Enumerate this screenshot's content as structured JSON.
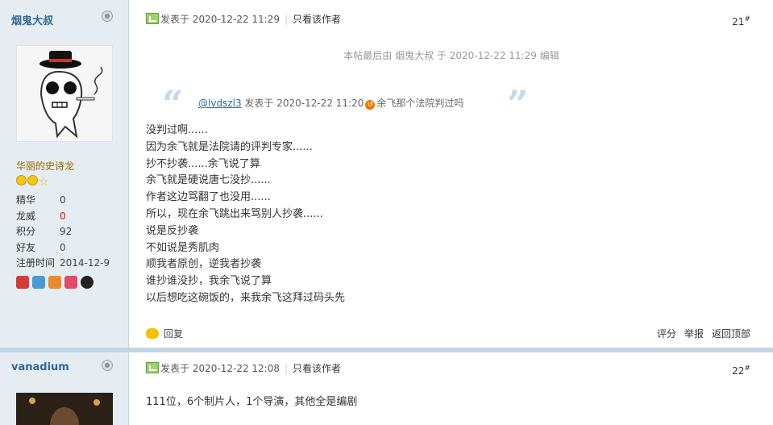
{
  "post1": {
    "author": "烟鬼大叔",
    "rank": "华丽的史诗龙",
    "stats": [
      {
        "label": "精华",
        "value": "0"
      },
      {
        "label": "龙威",
        "value": "0"
      },
      {
        "label": "积分",
        "value": "92"
      },
      {
        "label": "好友",
        "value": "0"
      },
      {
        "label": "注册时间",
        "value": "2014-12-9"
      }
    ],
    "posted_prefix": "发表于",
    "posted_time": "2020-12-22 11:29",
    "only_author": "只看该作者",
    "floor": "21",
    "edit_note": "本帖最后由 烟鬼大叔 于 2020-12-22 11:29 编辑",
    "quote": {
      "user": "@lvdszl3",
      "meta": "发表于 2020-12-22 11:20",
      "text": "余飞那个法院判过吗"
    },
    "lines": [
      "没判过啊......",
      "因为余飞就是法院请的评判专家......",
      "抄不抄袭......余飞说了算",
      "余飞就是硬说唐七没抄......",
      "作者这边骂翻了也没用......",
      "所以，现在余飞跳出来骂别人抄袭......",
      "说是反抄袭",
      "不如说是秀肌肉",
      "顺我者原创，逆我者抄袭",
      "谁抄谁没抄，我余飞说了算",
      "以后想吃这碗饭的，来我余飞这拜过码头先"
    ],
    "reply": "回复",
    "rate": "评分",
    "report": "举报",
    "back_top": "返回顶部"
  },
  "post2": {
    "author": "vanadium",
    "posted_prefix": "发表于",
    "posted_time": "2020-12-22 12:08",
    "only_author": "只看该作者",
    "floor": "22",
    "text": "111位，6个制片人，1个导演，其他全是编剧"
  },
  "colors": {
    "sidebar_bg": "#e5edf2",
    "divider": "#c2d5e3",
    "link": "#336699",
    "rank": "#996600",
    "red_value": "#ff0000"
  }
}
